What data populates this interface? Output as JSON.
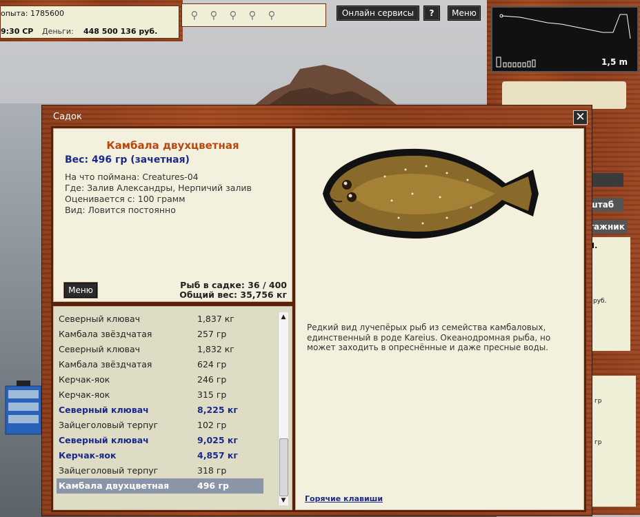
{
  "hud": {
    "experience": "опыта: 1785600",
    "time": "9:30 СР",
    "money_label": "Деньги:",
    "money_value": "448 500 136 руб.",
    "bait_icons": [
      "bait-slot-icon",
      "bait-slot-icon",
      "bait-slot-icon",
      "bait-slot-icon",
      "bait-slot-icon"
    ]
  },
  "toolbar": {
    "online_label": "Онлайн сервисы",
    "help_label": "?",
    "menu_label": "Меню"
  },
  "depth_gauge": {
    "value": "1,5 m"
  },
  "right_panel": {
    "scale_btn": "штаб",
    "stage_btn": "тажник",
    "money_fragment": "руб.",
    "gr1": "гр",
    "gr2": "гр",
    "dot": "I."
  },
  "dialog": {
    "title": "Садок",
    "close_label": "✕",
    "fish": {
      "name": "Камбала двухцветная",
      "weight": "Вес: 496 гр (зачетная)",
      "caught_with": "На что поймана: Creatures-04",
      "location": "Где: Залив Александры, Нерпичий залив",
      "rated_from": "Оценивается с: 100 грамм",
      "kind": "Вид: Ловится постоянно",
      "description": "Редкий вид лучепёрых рыб из семейства камбаловых, единственный в роде Kareius. Океанодромная рыба, но может заходить в опреснённые и даже пресные воды."
    },
    "menu_label": "Меню",
    "keepnet_count": "Рыб в садке: 36 / 400",
    "total_weight": "Общий вес: 35,756 кг",
    "hotkeys_label": "Горячие клавиши",
    "catch_list": [
      {
        "name": "Северный клювач",
        "weight": "1,837 кг",
        "highlight": false
      },
      {
        "name": "Камбала звёздчатая",
        "weight": "257 гр",
        "highlight": false
      },
      {
        "name": "Северный клювач",
        "weight": "1,832 кг",
        "highlight": false
      },
      {
        "name": "Камбала звёздчатая",
        "weight": "624 гр",
        "highlight": false
      },
      {
        "name": "Керчак-яок",
        "weight": "246 гр",
        "highlight": false
      },
      {
        "name": "Керчак-яок",
        "weight": "315 гр",
        "highlight": false
      },
      {
        "name": "Северный клювач",
        "weight": "8,225 кг",
        "highlight": true
      },
      {
        "name": "Зайцеголовый терпуг",
        "weight": "102 гр",
        "highlight": false
      },
      {
        "name": "Северный клювач",
        "weight": "9,025 кг",
        "highlight": true
      },
      {
        "name": "Керчак-яок",
        "weight": "4,857 кг",
        "highlight": true
      },
      {
        "name": "Зайцеголовый терпуг",
        "weight": "318 гр",
        "highlight": false
      },
      {
        "name": "Камбала двухцветная",
        "weight": "496 гр",
        "highlight": false,
        "selected": true
      }
    ]
  }
}
